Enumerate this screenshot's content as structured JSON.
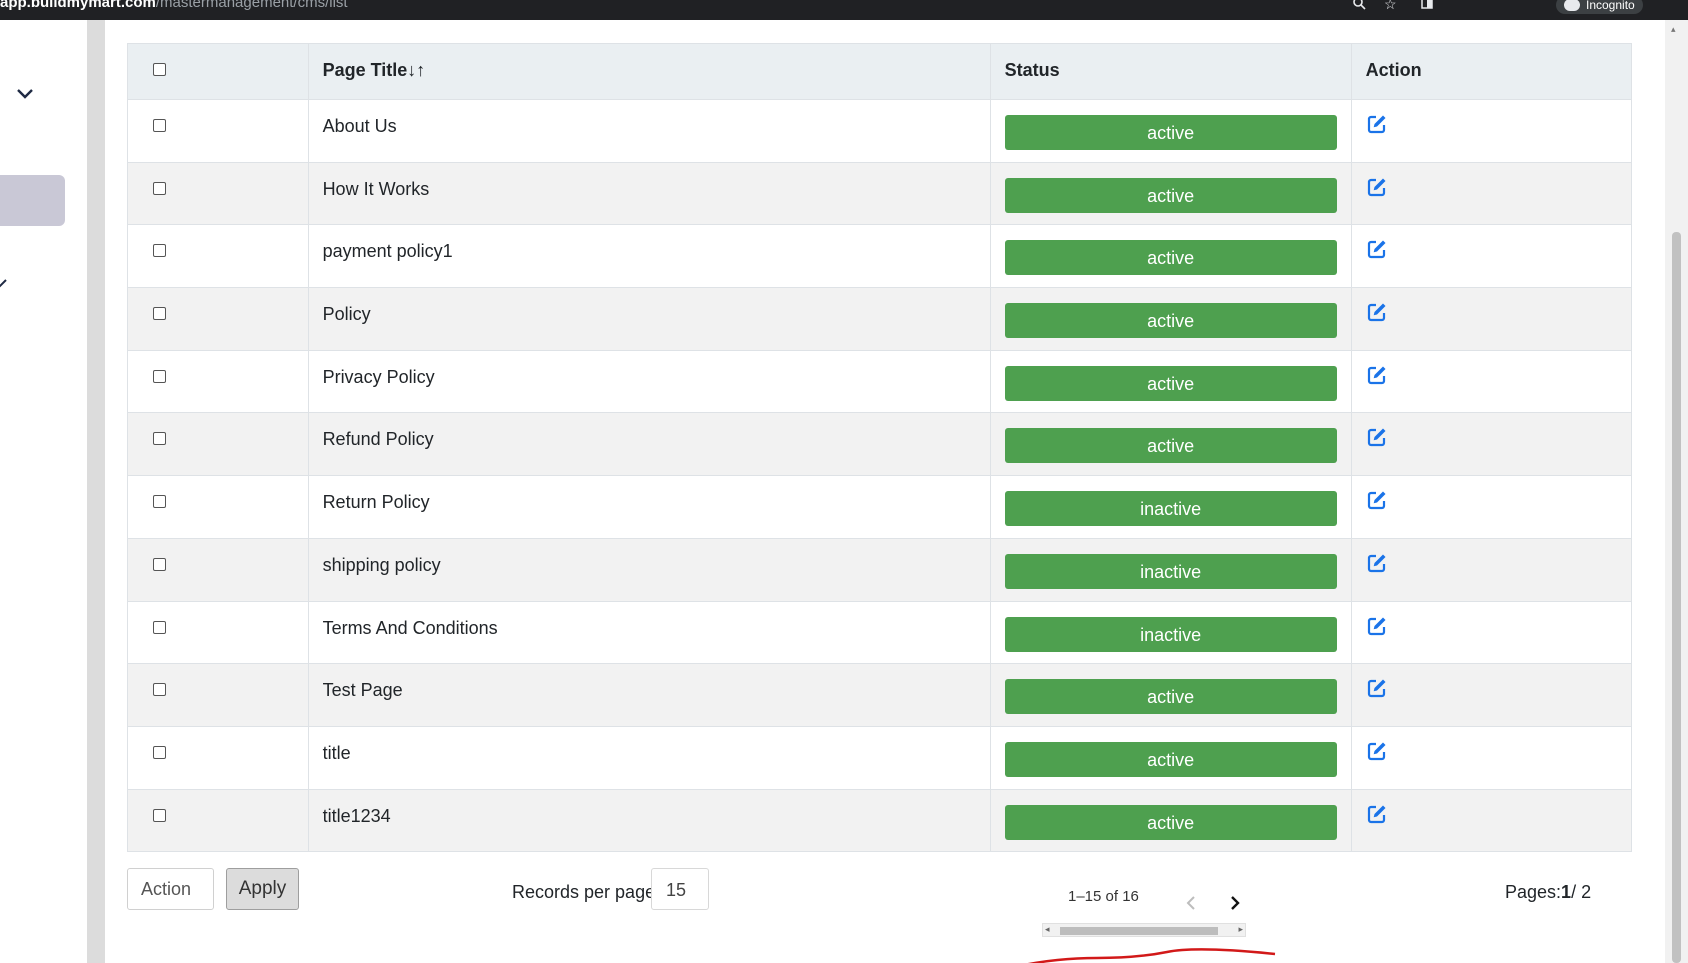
{
  "browser": {
    "url_host": "app.buildmymart.com",
    "url_path": "/mastermanagement/cms/list",
    "incognito_label": "Incognito"
  },
  "table": {
    "headers": {
      "title": "Page Title↓↑",
      "status": "Status",
      "action": "Action"
    },
    "rows": [
      {
        "title": "About Us",
        "status": "active"
      },
      {
        "title": "How It Works",
        "status": "active"
      },
      {
        "title": "payment policy1",
        "status": "active"
      },
      {
        "title": "Policy",
        "status": "active"
      },
      {
        "title": "Privacy Policy",
        "status": "active"
      },
      {
        "title": "Refund Policy",
        "status": "active"
      },
      {
        "title": "Return Policy",
        "status": "inactive"
      },
      {
        "title": "shipping policy",
        "status": "inactive"
      },
      {
        "title": "Terms And Conditions",
        "status": "inactive"
      },
      {
        "title": "Test Page",
        "status": "active"
      },
      {
        "title": "title",
        "status": "active"
      },
      {
        "title": "title1234",
        "status": "active"
      }
    ]
  },
  "footer": {
    "action_label": "Action",
    "apply_label": "Apply",
    "records_per_page_label": "Records per page:",
    "records_per_page_value": "15",
    "range_text": "1–15 of 16",
    "pages_label": "Pages:",
    "current_page": "1",
    "total_pages": "/ 2"
  },
  "colors": {
    "status_badge": "#4ea04f",
    "edit_icon": "#1a73e8",
    "header_bg": "#eaeff2"
  },
  "icons": {
    "edit": "edit-square-icon",
    "next": "chevron-right-icon",
    "prev": "chevron-left-icon"
  }
}
